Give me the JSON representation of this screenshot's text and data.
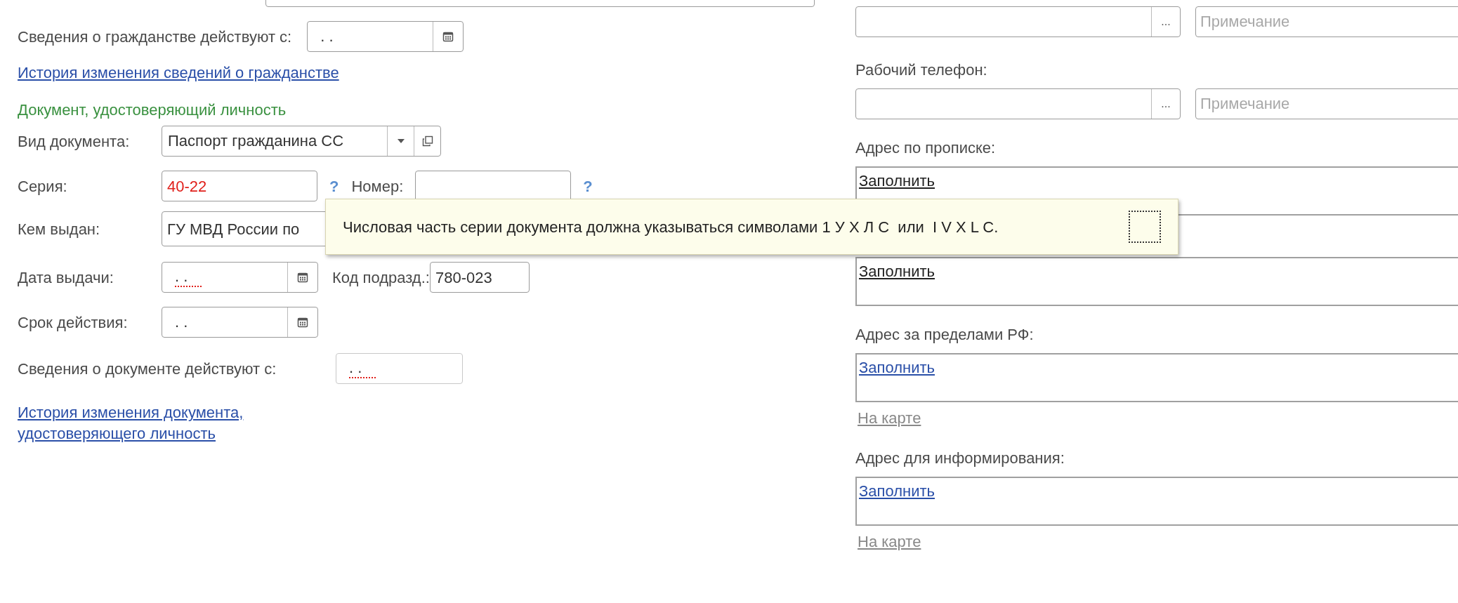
{
  "citizenship_since": {
    "label": "Сведения о гражданстве действуют с:",
    "value": ".  ."
  },
  "citizenship_history_link": "История изменения сведений о гражданстве",
  "identity_document": {
    "heading": "Документ, удостоверяющий личность",
    "doc_type": {
      "label": "Вид документа:",
      "value": "Паспорт гражданина СС"
    },
    "series": {
      "label": "Серия:",
      "value": "40-22",
      "invalid": true,
      "help": "?"
    },
    "number": {
      "label": "Номер:",
      "help": "?"
    },
    "issued_by": {
      "label": "Кем выдан:",
      "value": "ГУ МВД России по"
    },
    "issue_date": {
      "label": "Дата выдачи:",
      "value": ".  .",
      "required": true
    },
    "dept_code": {
      "label": "Код подразд.:",
      "value": "780-023"
    },
    "expiry": {
      "label": "Срок действия:",
      "value": ".  .",
      "required": false
    },
    "doc_since": {
      "label": "Сведения о документе действуют с:",
      "value": ".  .",
      "required": true
    },
    "history_link": "История изменения документа, удостоверяющего личность"
  },
  "phones": [
    {
      "button": "...",
      "placeholder": "Примечание"
    },
    {
      "label": "Рабочий телефон:",
      "button": "...",
      "placeholder": "Примечание"
    }
  ],
  "addresses": [
    {
      "label": "Адрес по прописке:",
      "fill_link": "Заполнить",
      "visited": true
    },
    {
      "fill_link": "Заполнить",
      "visited": true
    },
    {
      "label": "Адрес за пределами РФ:",
      "fill_link": "Заполнить",
      "visited": false,
      "map_link": "На карте"
    },
    {
      "label": "Адрес для информирования:",
      "fill_link": "Заполнить",
      "visited": false,
      "map_link": "На карте"
    }
  ],
  "tooltip": {
    "text": "Числовая часть серии документа должна указываться символами 1 У Х Л С  или  I V X L C."
  }
}
